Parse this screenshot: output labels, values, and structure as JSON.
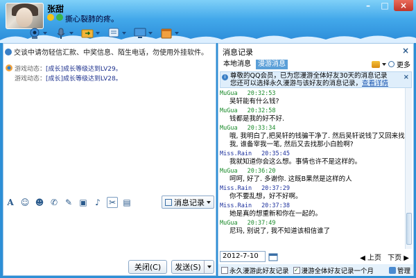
{
  "header": {
    "contact_name": "张甜",
    "signature": "撕心裂肺的疼。",
    "toolbar_icons": [
      "video-call-icon",
      "voice-call-icon",
      "send-file-icon",
      "sms-icon",
      "remote-desktop-icon",
      "apps-icon"
    ]
  },
  "window_controls": {
    "minimize": "–",
    "maximize": "□",
    "close": "×"
  },
  "left": {
    "security_notice": "交谈中请勿轻信汇款、中奖信息、陌生电话，勿使用外挂软件。",
    "game_feed": [
      {
        "label": "游戏动态：",
        "text": "[成长]成长等级达到LV29。"
      },
      {
        "label": "游戏动态：",
        "text": "[成长]成长等级达到LV28。"
      }
    ],
    "history_button": "消息记录",
    "close_button": "关闭(C)",
    "send_button": "发送(S)"
  },
  "right": {
    "title": "消息记录",
    "tabs": [
      "本地消息",
      "漫游消息"
    ],
    "more": "更多",
    "banner_line1": "尊敬的QQ会员，已为您漫游全体好友30天的消息记录",
    "banner_line2": "您还可以选择永久漫游与该好友的消息记录，",
    "banner_link": "查看详情",
    "messages": [
      {
        "sender": "MuGua",
        "time": "20:32:53",
        "text": "吴轩能有什么钱?"
      },
      {
        "sender": "MuGua",
        "time": "20:32:58",
        "text": "钱都是我的好不好."
      },
      {
        "sender": "MuGua",
        "time": "20:33:34",
        "text": "哦, 我明白了,把吴轩的钱骗干净了. 然后吴轩说钱了又回来找我, 谁备宰我一笔, 然后又去找那小白脸啊?"
      },
      {
        "sender": "Miss.Rain",
        "time": "20:35:45",
        "text": "我就知道你会这么想。事情也许不是这样的。"
      },
      {
        "sender": "MuGua",
        "time": "20:36:20",
        "text": "呵呵, 好了. 多谢你. 这既B果然是这样的人"
      },
      {
        "sender": "Miss.Rain",
        "time": "20:37:29",
        "text": "你不要乱想，好不好啊。"
      },
      {
        "sender": "Miss.Rain",
        "time": "20:37:38",
        "text": "她是真的想重新和你在一起的。"
      },
      {
        "sender": "MuGua",
        "time": "20:37:49",
        "text": "尼玛, 别说了, 我不知道该相信谁了"
      }
    ],
    "date": "2012-7-10",
    "prev_page": "上页",
    "next_page": "下页",
    "option_permanent": "永久漫游此好友记录",
    "option_all_month": "漫游全体好友记录一个月",
    "manage": "管理"
  }
}
